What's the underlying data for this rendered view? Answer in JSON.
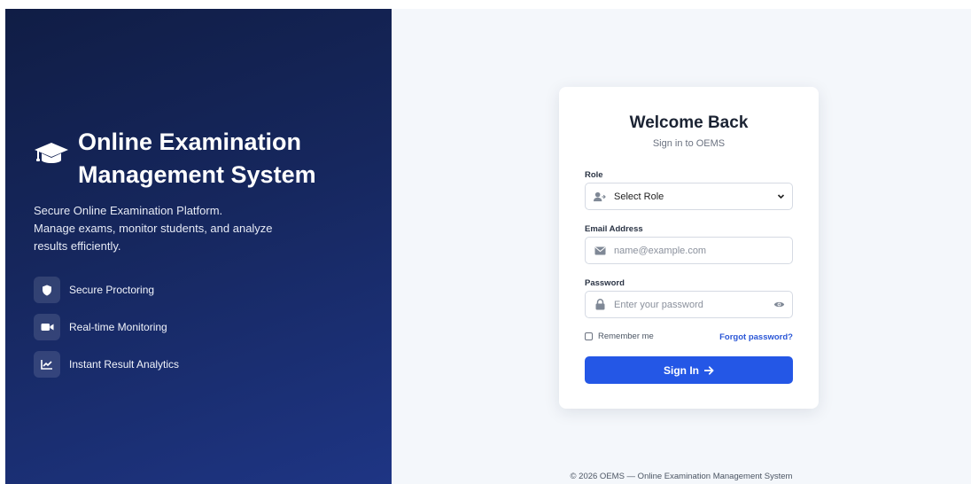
{
  "brand": {
    "title": "Online Examination Management System",
    "tagline_line1": "Secure Online Examination Platform.",
    "tagline_line2": "Manage exams, monitor students, and analyze results efficiently."
  },
  "features": [
    {
      "label": "Secure Proctoring",
      "icon": "shield-icon"
    },
    {
      "label": "Real-time Monitoring",
      "icon": "video-camera-icon"
    },
    {
      "label": "Instant Result Analytics",
      "icon": "line-chart-icon"
    }
  ],
  "login": {
    "title": "Welcome Back",
    "subtitle": "Sign in to OEMS",
    "role_label": "Role",
    "role_value": "Select Role",
    "email_label": "Email Address",
    "email_placeholder": "name@example.com",
    "password_label": "Password",
    "password_placeholder": "Enter your password",
    "remember_label": "Remember me",
    "forgot_label": "Forgot password?",
    "submit_label": "Sign In"
  },
  "footer": "© 2026 OEMS — Online Examination Management System",
  "colors": {
    "panel_dark": "#101d45",
    "panel_light": "#1e3584",
    "accent": "#2457e6",
    "link": "#2a56d6",
    "background": "#f4f7fb"
  }
}
